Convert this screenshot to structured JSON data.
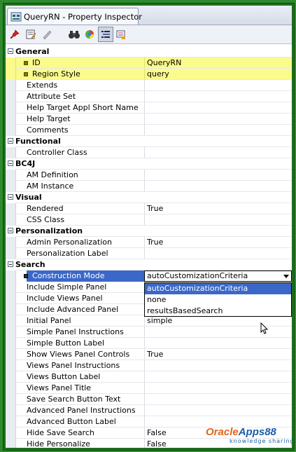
{
  "window": {
    "title": "QueryRN - Property Inspector"
  },
  "toolbar": {
    "icons": [
      "pin-icon",
      "edit-properties-icon",
      "pencil-icon",
      "binoculars-icon",
      "color-wheel-icon",
      "categorize-icon",
      "alphabetical-icon"
    ]
  },
  "categories": {
    "general": "General",
    "functional": "Functional",
    "bc4j": "BC4J",
    "visual": "Visual",
    "personalization": "Personalization",
    "search": "Search"
  },
  "general": {
    "id": {
      "name": "ID",
      "value": "QueryRN"
    },
    "region_style": {
      "name": "Region Style",
      "value": "query"
    },
    "extends": {
      "name": "Extends",
      "value": ""
    },
    "attribute_set": {
      "name": "Attribute Set",
      "value": ""
    },
    "help_target_appl": {
      "name": "Help Target Appl Short Name",
      "value": ""
    },
    "help_target": {
      "name": "Help Target",
      "value": ""
    },
    "comments": {
      "name": "Comments",
      "value": ""
    }
  },
  "functional": {
    "controller_class": {
      "name": "Controller Class",
      "value": ""
    }
  },
  "bc4j": {
    "am_definition": {
      "name": "AM Definition",
      "value": ""
    },
    "am_instance": {
      "name": "AM Instance",
      "value": ""
    }
  },
  "visual": {
    "rendered": {
      "name": "Rendered",
      "value": "True"
    },
    "css_class": {
      "name": "CSS Class",
      "value": ""
    }
  },
  "personalization": {
    "admin": {
      "name": "Admin Personalization",
      "value": "True"
    },
    "label": {
      "name": "Personalization Label",
      "value": ""
    }
  },
  "search": {
    "construction_mode": {
      "name": "Construction Mode",
      "value": "autoCustomizationCriteria"
    },
    "include_simple": {
      "name": "Include Simple Panel",
      "value": ""
    },
    "include_views": {
      "name": "Include Views Panel",
      "value": ""
    },
    "include_advanced": {
      "name": "Include Advanced Panel",
      "value": ""
    },
    "initial_panel": {
      "name": "Initial Panel",
      "value": "simple"
    },
    "simple_instructions": {
      "name": "Simple Panel Instructions",
      "value": ""
    },
    "simple_button": {
      "name": "Simple Button Label",
      "value": ""
    },
    "show_views_controls": {
      "name": "Show Views Panel Controls",
      "value": "True"
    },
    "views_instructions": {
      "name": "Views Panel Instructions",
      "value": ""
    },
    "views_button": {
      "name": "Views Button Label",
      "value": ""
    },
    "views_title": {
      "name": "Views Panel Title",
      "value": ""
    },
    "save_search_button": {
      "name": "Save Search Button Text",
      "value": ""
    },
    "advanced_instructions": {
      "name": "Advanced Panel Instructions",
      "value": ""
    },
    "advanced_button": {
      "name": "Advanced Button Label",
      "value": ""
    },
    "hide_save_search": {
      "name": "Hide Save Search",
      "value": "False"
    },
    "hide_personalize": {
      "name": "Hide Personalize",
      "value": "False"
    }
  },
  "dropdown": {
    "options": [
      "autoCustomizationCriteria",
      "none",
      "resultsBasedSearch"
    ],
    "highlighted": "autoCustomizationCriteria"
  },
  "watermark": {
    "brand_part1": "Oracle",
    "brand_part2": "Apps88",
    "tagline": "knowledge sharing"
  },
  "colors": {
    "required_row": "#fbfb8c",
    "selection": "#3b68c8",
    "frame": "#2f8a2f"
  }
}
